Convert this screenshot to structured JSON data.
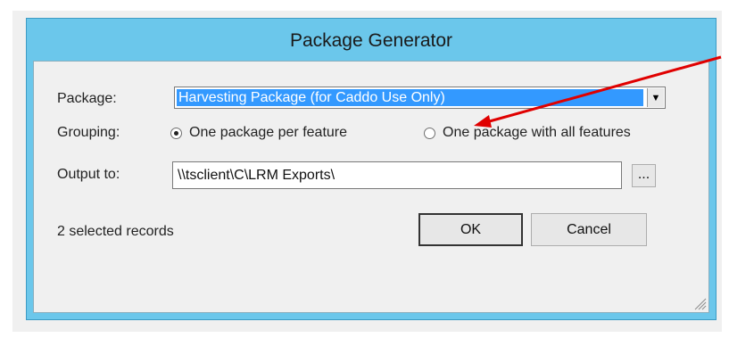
{
  "window": {
    "title": "Package Generator"
  },
  "form": {
    "package_label": "Package:",
    "package_selected": "Harvesting Package (for Caddo Use Only)",
    "grouping_label": "Grouping:",
    "grouping_options": [
      {
        "label": "One package per feature",
        "checked": true
      },
      {
        "label": "One package with all features",
        "checked": false
      }
    ],
    "output_label": "Output to:",
    "output_value": "\\\\tsclient\\C\\LRM Exports\\",
    "browse_label": "..."
  },
  "footer": {
    "status_text": "2 selected records",
    "ok_label": "OK",
    "cancel_label": "Cancel"
  },
  "annotation": {
    "color": "#e00000"
  },
  "icons": {
    "dropdown": "chevron-down-icon",
    "resize": "resize-grip-icon"
  }
}
